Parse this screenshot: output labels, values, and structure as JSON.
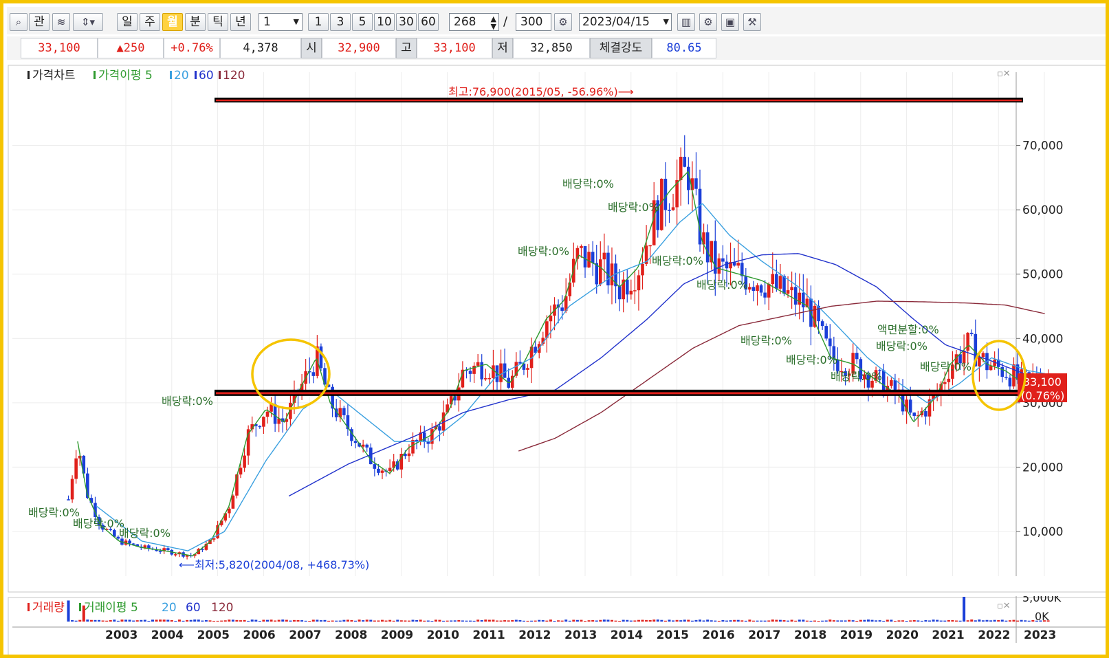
{
  "toolbar": {
    "search_icon": "magnifier",
    "buttons": [
      "관",
      "일",
      "주",
      "월",
      "분",
      "틱",
      "년"
    ],
    "active_period": "월",
    "period_select_value": "1",
    "intervals": [
      "1",
      "3",
      "5",
      "10",
      "30",
      "60"
    ],
    "count_value": "268",
    "count_sep": "/",
    "count_total": "300",
    "date_value": "2023/04/15",
    "right_icons": [
      "chart-icon",
      "gear-icon",
      "save-icon",
      "tools-icon"
    ]
  },
  "quote": {
    "price": "33,100",
    "change": "▲250",
    "change_pct": "+0.76%",
    "volume": "4,378",
    "open_label": "시",
    "open": "32,900",
    "high_label": "고",
    "high": "33,100",
    "low_label": "저",
    "low": "32,850",
    "strength_label": "체결강도",
    "strength": "80.65"
  },
  "price_legend": {
    "title": "가격차트",
    "ma_label": "가격이평",
    "ma": [
      "5",
      "20",
      "60",
      "120"
    ]
  },
  "volume_legend": {
    "title": "거래량",
    "ma_label": "거래이평",
    "ma": [
      "5",
      "20",
      "60",
      "120"
    ]
  },
  "annotations": {
    "high": "최고:76,900(2015/05, -56.96%)⟶",
    "low": "⟵최저:5,820(2004/08, +468.73%)",
    "dividend": "배당락:0%",
    "split": "액면분할:0%",
    "current_price": "33,100",
    "current_pct": "(0.76%)"
  },
  "colors": {
    "up": "#e0201b",
    "down": "#1b3fd8",
    "ma5": "#2e9a2e",
    "ma20": "#3aa0e0",
    "ma60": "#2233cc",
    "ma120": "#8a2a3a",
    "highlight": "#f5c400"
  },
  "chart_data": {
    "type": "candlestick",
    "period": "monthly",
    "y_ticks": [
      "10,000",
      "20,000",
      "30,000",
      "40,000",
      "50,000",
      "60,000",
      "70,000"
    ],
    "ylim": [
      4000,
      78000
    ],
    "x_ticks": [
      "2003",
      "2004",
      "2005",
      "2006",
      "2007",
      "2008",
      "2009",
      "2010",
      "2011",
      "2012",
      "2013",
      "2014",
      "2015",
      "2016",
      "2017",
      "2018",
      "2019",
      "2020",
      "2021",
      "2022",
      "2023"
    ],
    "vol_ticks": [
      "5,000K",
      "0K"
    ],
    "all_time_high": 76900,
    "all_time_low": 5820,
    "support_level": 31500,
    "resistance_level": 76900,
    "close_anchors": [
      [
        2001.9,
        15000
      ],
      [
        2002.1,
        24000
      ],
      [
        2002.3,
        16000
      ],
      [
        2002.6,
        11000
      ],
      [
        2003.0,
        8500
      ],
      [
        2003.5,
        7500
      ],
      [
        2004.0,
        7000
      ],
      [
        2004.6,
        6200
      ],
      [
        2005.0,
        8500
      ],
      [
        2005.4,
        14000
      ],
      [
        2005.8,
        25000
      ],
      [
        2006.2,
        29000
      ],
      [
        2006.6,
        27000
      ],
      [
        2007.0,
        33000
      ],
      [
        2007.3,
        37000
      ],
      [
        2007.6,
        30000
      ],
      [
        2008.0,
        26000
      ],
      [
        2008.5,
        21000
      ],
      [
        2008.9,
        19000
      ],
      [
        2009.3,
        23000
      ],
      [
        2009.8,
        25000
      ],
      [
        2010.2,
        29000
      ],
      [
        2010.5,
        35000
      ],
      [
        2011.0,
        36000
      ],
      [
        2011.5,
        33000
      ],
      [
        2011.8,
        36000
      ],
      [
        2012.3,
        43000
      ],
      [
        2012.7,
        46000
      ],
      [
        2013.0,
        53000
      ],
      [
        2013.5,
        51000
      ],
      [
        2013.9,
        48000
      ],
      [
        2014.3,
        51000
      ],
      [
        2014.7,
        60000
      ],
      [
        2015.0,
        63000
      ],
      [
        2015.4,
        66000
      ],
      [
        2015.7,
        55000
      ],
      [
        2016.0,
        51000
      ],
      [
        2016.5,
        50000
      ],
      [
        2017.0,
        49000
      ],
      [
        2017.5,
        47000
      ],
      [
        2018.0,
        45000
      ],
      [
        2018.5,
        37000
      ],
      [
        2019.0,
        36000
      ],
      [
        2019.6,
        33000
      ],
      [
        2020.0,
        31000
      ],
      [
        2020.3,
        27000
      ],
      [
        2020.8,
        31000
      ],
      [
        2021.1,
        36000
      ],
      [
        2021.5,
        39000
      ],
      [
        2021.9,
        36000
      ],
      [
        2022.3,
        35000
      ],
      [
        2022.7,
        33000
      ],
      [
        2023.0,
        34000
      ],
      [
        2023.28,
        33100
      ]
    ],
    "ma20_anchors": [
      [
        2002.5,
        14000
      ],
      [
        2003.5,
        8500
      ],
      [
        2004.5,
        7000
      ],
      [
        2005.3,
        10000
      ],
      [
        2006.2,
        21000
      ],
      [
        2007.0,
        29000
      ],
      [
        2007.6,
        32000
      ],
      [
        2008.3,
        28000
      ],
      [
        2009.0,
        24000
      ],
      [
        2009.8,
        24000
      ],
      [
        2010.5,
        28000
      ],
      [
        2011.2,
        34000
      ],
      [
        2012.0,
        37000
      ],
      [
        2012.8,
        45000
      ],
      [
        2013.8,
        50000
      ],
      [
        2014.5,
        52000
      ],
      [
        2015.2,
        58000
      ],
      [
        2015.7,
        61000
      ],
      [
        2016.3,
        56000
      ],
      [
        2017.0,
        52000
      ],
      [
        2017.8,
        48000
      ],
      [
        2018.5,
        43000
      ],
      [
        2019.3,
        37000
      ],
      [
        2020.0,
        33000
      ],
      [
        2020.6,
        30000
      ],
      [
        2021.3,
        33000
      ],
      [
        2022.0,
        37000
      ],
      [
        2022.8,
        35000
      ],
      [
        2023.2,
        34500
      ]
    ],
    "ma60_anchors": [
      [
        2006.7,
        15500
      ],
      [
        2008.0,
        20500
      ],
      [
        2009.5,
        25000
      ],
      [
        2010.5,
        28500
      ],
      [
        2011.5,
        30500
      ],
      [
        2012.5,
        32000
      ],
      [
        2013.5,
        37000
      ],
      [
        2014.5,
        43000
      ],
      [
        2015.3,
        48500
      ],
      [
        2016.2,
        51500
      ],
      [
        2017.0,
        53000
      ],
      [
        2017.8,
        53200
      ],
      [
        2018.6,
        51500
      ],
      [
        2019.5,
        48000
      ],
      [
        2020.3,
        43000
      ],
      [
        2021.0,
        39000
      ],
      [
        2022.0,
        36500
      ],
      [
        2022.9,
        34000
      ],
      [
        2023.2,
        33500
      ]
    ],
    "ma120_anchors": [
      [
        2011.7,
        22500
      ],
      [
        2012.5,
        24500
      ],
      [
        2013.5,
        28500
      ],
      [
        2014.5,
        33500
      ],
      [
        2015.5,
        38500
      ],
      [
        2016.5,
        42000
      ],
      [
        2017.5,
        43500
      ],
      [
        2018.5,
        45000
      ],
      [
        2019.5,
        45800
      ],
      [
        2020.5,
        45700
      ],
      [
        2021.5,
        45500
      ],
      [
        2022.3,
        45200
      ],
      [
        2023.2,
        43800
      ]
    ],
    "volume_spikes": [
      [
        2001.9,
        0.85
      ],
      [
        2002.2,
        0.65
      ],
      [
        2021.4,
        1.0
      ]
    ]
  }
}
